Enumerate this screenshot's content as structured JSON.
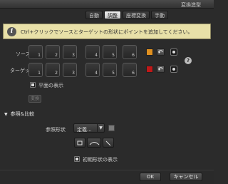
{
  "window": {
    "title": "変換造型"
  },
  "tabs": [
    {
      "label": "自動",
      "active": false
    },
    {
      "label": "調整",
      "active": true
    },
    {
      "label": "座標変換",
      "active": false
    },
    {
      "label": "手動",
      "active": false
    }
  ],
  "info": {
    "icon": "info-icon",
    "text": "Ctrl+クリックでソースとターゲットの形状にポイントを追加してください。"
  },
  "source": {
    "label": "ソース",
    "boxes": [
      "1",
      "2",
      "3",
      "4",
      "5",
      "6"
    ],
    "swatch_color": "#e09020"
  },
  "target": {
    "label": "ターゲット",
    "boxes": [
      "1",
      "2",
      "3",
      "4",
      "5",
      "6"
    ],
    "swatch_color": "#c01818"
  },
  "help": {
    "glyph": "?"
  },
  "plane_display": {
    "label": "平面の表示",
    "checked": true
  },
  "convert_button": {
    "label": "変換"
  },
  "reference": {
    "section_label": "参照&比較",
    "shape_label": "参照形状",
    "shape_value": "定義..."
  },
  "initial_shape_display": {
    "label": "初期形状の表示",
    "checked": true
  },
  "footer": {
    "ok_label": "OK",
    "cancel_label": "キャンセル"
  }
}
